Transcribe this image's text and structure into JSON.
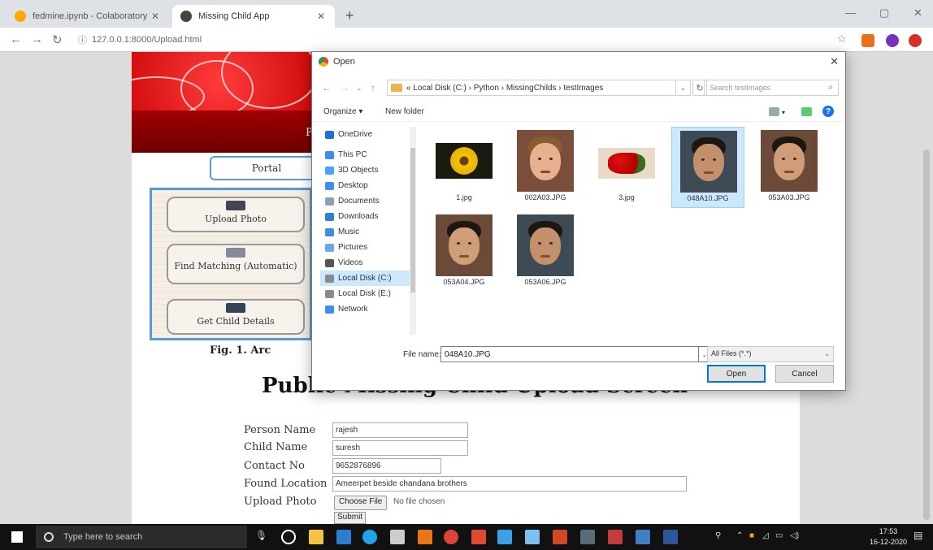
{
  "browser": {
    "tabs": [
      {
        "label": "fedmine.ipynb - Colaboratory",
        "active": false
      },
      {
        "label": "Missing Child App",
        "active": true
      }
    ],
    "url": "127.0.0.1:8000/Upload.html",
    "new_tab": "+",
    "controls": {
      "minimize": "—",
      "restore": "▢",
      "close": "✕"
    }
  },
  "page": {
    "banner_letter": "P",
    "portal_label": "Portal",
    "architecture": {
      "boxes": [
        "Upload Photo",
        "Find Matching (Automatic)",
        "Get Child Details"
      ],
      "caption": "Fig. 1.   Arc"
    },
    "title": "Public Missing Child Upload Screen",
    "form": {
      "person_name_label": "Person Name",
      "person_name_value": "rajesh",
      "child_name_label": "Child Name",
      "child_name_value": "suresh",
      "contact_label": "Contact No",
      "contact_value": "9652876896",
      "location_label": "Found Location",
      "location_value": "Ameerpet beside chandana brothers",
      "photo_label": "Upload Photo",
      "choose_file": "Choose File",
      "no_file": "No file chosen",
      "submit": "Submit"
    }
  },
  "dialog": {
    "title": "Open",
    "close": "✕",
    "breadcrumb": "« Local Disk (C:)  ›  Python  ›  MissingChilds  ›  testImages",
    "search_placeholder": "Search testImages",
    "organize": "Organize ▾",
    "new_folder": "New folder",
    "nav_items": [
      {
        "label": "OneDrive",
        "color": "#1e6fd9"
      },
      {
        "label": "This PC",
        "color": "#3c8ee6"
      },
      {
        "label": "3D Objects",
        "color": "#4aa3ff"
      },
      {
        "label": "Desktop",
        "color": "#3c8ee6"
      },
      {
        "label": "Documents",
        "color": "#8aa0b8"
      },
      {
        "label": "Downloads",
        "color": "#2f7fd6"
      },
      {
        "label": "Music",
        "color": "#3c8ee6"
      },
      {
        "label": "Pictures",
        "color": "#6aa8e8"
      },
      {
        "label": "Videos",
        "color": "#555555"
      },
      {
        "label": "Local Disk (C:)",
        "color": "#8a8a8a",
        "selected": true
      },
      {
        "label": "Local Disk (E:)",
        "color": "#8a8a8a"
      },
      {
        "label": "Network",
        "color": "#3c8ee6"
      }
    ],
    "files": [
      {
        "name": "1.jpg",
        "kind": "flower"
      },
      {
        "name": "002A03.JPG",
        "kind": "face-light"
      },
      {
        "name": "3.jpg",
        "kind": "roses"
      },
      {
        "name": "048A10.JPG",
        "kind": "face-dark",
        "selected": true
      },
      {
        "name": "053A03.JPG",
        "kind": "face-mid"
      },
      {
        "name": "053A04.JPG",
        "kind": "face-mid"
      },
      {
        "name": "053A06.JPG",
        "kind": "face-dark"
      }
    ],
    "file_name_label": "File name:",
    "file_name_value": "048A10.JPG",
    "file_type": "All Files (*.*)",
    "open": "Open",
    "cancel": "Cancel"
  },
  "taskbar": {
    "search_placeholder": "Type here to search",
    "time": "17:53",
    "date": "16-12-2020"
  }
}
